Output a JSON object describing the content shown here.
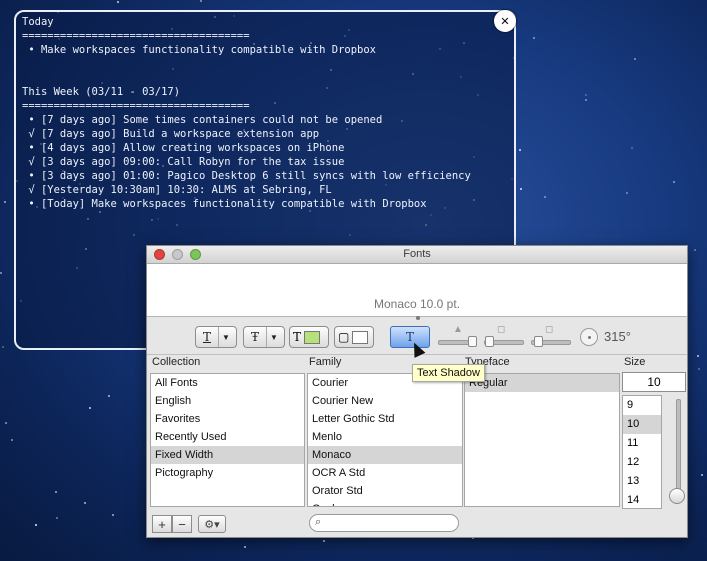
{
  "notes": {
    "lines": [
      "Today",
      "====================================",
      " • Make workspaces functionality compatible with Dropbox",
      "",
      "",
      "This Week (03/11 - 03/17)",
      "====================================",
      " • [7 days ago] Some times containers could not be opened",
      " √ [7 days ago] Build a workspace extension app",
      " • [4 days ago] Allow creating workspaces on iPhone",
      " √ [3 days ago] 09:00: Call Robyn for the tax issue",
      " • [3 days ago] 01:00: Pagico Desktop 6 still syncs with low efficiency",
      " √ [Yesterday 10:30am] 10:30: ALMS at Sebring, FL",
      " • [Today] Make workspaces functionality compatible with Dropbox"
    ],
    "close_glyph": "✕"
  },
  "fonts_panel": {
    "title": "Fonts",
    "preview_text": "Monaco 10.0 pt.",
    "toolbar": {
      "underline_glyph": "T",
      "strike_glyph": "Ŧ",
      "text_color_glyph": "T",
      "doc_color_glyph": "▢",
      "shadow_glyph": "T",
      "text_color": "#b7e07a",
      "doc_color": "#ffffff",
      "shadow_angle": "315°"
    },
    "headers": {
      "collection": "Collection",
      "family": "Family",
      "typeface": "Typeface",
      "size": "Size"
    },
    "collections": [
      "All Fonts",
      "English",
      "Favorites",
      "Recently Used",
      "Fixed Width",
      "Pictography"
    ],
    "collection_selected": "Fixed Width",
    "families": [
      "Courier",
      "Courier New",
      "Letter Gothic Std",
      "Menlo",
      "Monaco",
      "OCR A Std",
      "Orator Std",
      "Osaka"
    ],
    "family_selected": "Monaco",
    "typefaces": [
      "Regular"
    ],
    "typeface_selected": "Regular",
    "size_value": "10",
    "sizes": [
      "9",
      "10",
      "11",
      "12",
      "13",
      "14"
    ],
    "size_selected": "10",
    "add_glyph": "+",
    "remove_glyph": "−",
    "gear_glyph": "⚙▾",
    "search_placeholder": ""
  },
  "tooltip": "Text Shadow"
}
